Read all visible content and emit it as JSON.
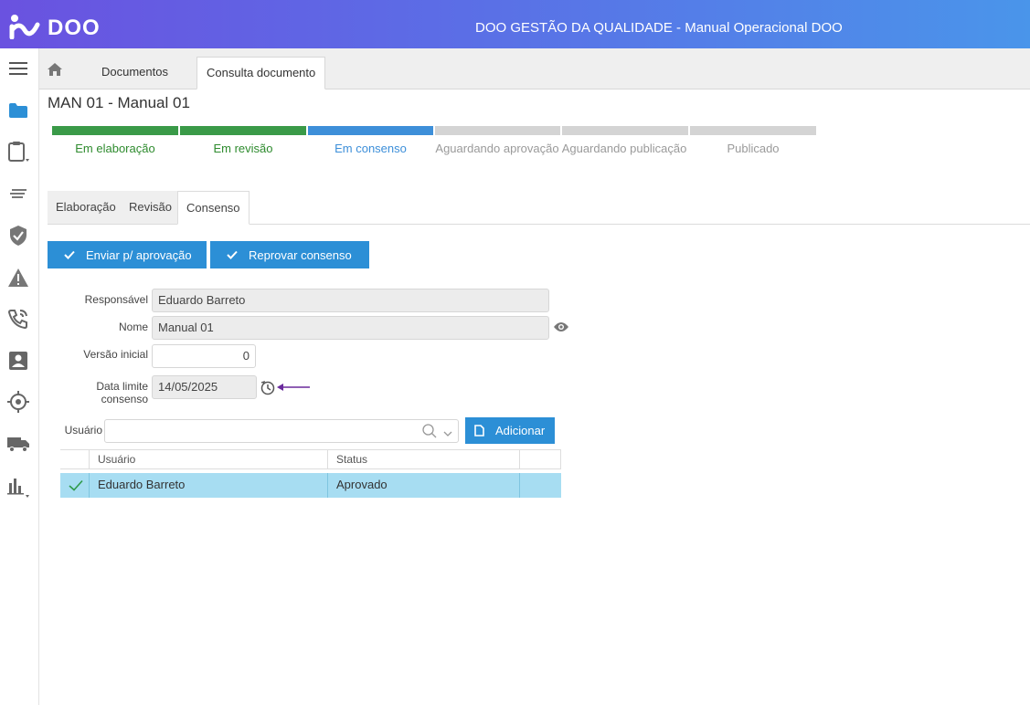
{
  "header": {
    "logo_text": "DOO",
    "title": "DOO GESTÃO DA QUALIDADE - Manual Operacional DOO"
  },
  "sidebar": {
    "items": [
      {
        "icon": "menu-icon"
      },
      {
        "icon": "folder-icon"
      },
      {
        "icon": "clipboard-icon"
      },
      {
        "icon": "lines-icon"
      },
      {
        "icon": "shield-check-icon"
      },
      {
        "icon": "warning-icon"
      },
      {
        "icon": "phone-icon"
      },
      {
        "icon": "contact-card-icon"
      },
      {
        "icon": "target-icon"
      },
      {
        "icon": "truck-icon"
      },
      {
        "icon": "bar-chart-icon"
      }
    ]
  },
  "tabs": {
    "items": [
      "Documentos",
      "Consulta documento"
    ],
    "active": "Consulta documento"
  },
  "page": {
    "title": "MAN 01 - Manual 01"
  },
  "steps": {
    "items": [
      {
        "label": "Em elaboração",
        "state": "done"
      },
      {
        "label": "Em revisão",
        "state": "done"
      },
      {
        "label": "Em consenso",
        "state": "current"
      },
      {
        "label": "Aguardando aprovação",
        "state": "pending"
      },
      {
        "label": "Aguardando publicação",
        "state": "pending"
      },
      {
        "label": "Publicado",
        "state": "pending"
      }
    ],
    "colors": {
      "done": "#3a9a48",
      "current": "#3d8fd9",
      "pending": "#d4d4d4",
      "done_text": "#2e8b2e",
      "current_text": "#3d8fd9",
      "pending_text": "#9a9a9a"
    }
  },
  "inner_tabs": {
    "items": [
      "Elaboração",
      "Revisão",
      "Consenso"
    ],
    "active": "Consenso"
  },
  "actions": {
    "send_approval": "Enviar p/ aprovação",
    "reject_consensus": "Reprovar consenso"
  },
  "form": {
    "responsavel_label": "Responsável",
    "responsavel_value": "Eduardo Barreto",
    "nome_label": "Nome",
    "nome_value": "Manual 01",
    "versao_label": "Versão inicial",
    "versao_value": "0",
    "data_limite_label": "Data limite consenso",
    "data_limite_value": "14/05/2025"
  },
  "users": {
    "label": "Usuário",
    "search_value": "",
    "add_button": "Adicionar",
    "columns": [
      "Usuário",
      "Status"
    ],
    "rows": [
      {
        "usuario": "Eduardo Barreto",
        "status": "Aprovado",
        "checked": true
      }
    ]
  },
  "colors": {
    "accent": "#2c8fd6",
    "row_highlight": "#a7ddf2",
    "annotation_arrow": "#6a2a9c"
  }
}
